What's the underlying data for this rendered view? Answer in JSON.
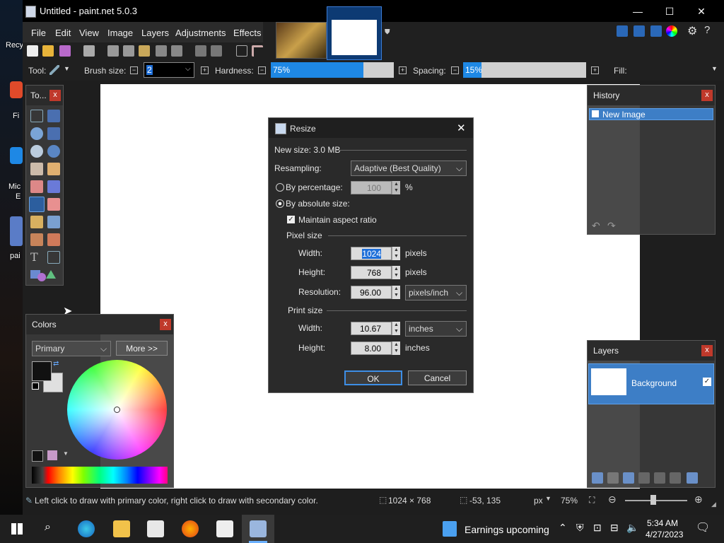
{
  "desktop": {
    "labels": [
      "Recy",
      "Fi",
      "Mic",
      "E",
      "pai"
    ]
  },
  "window": {
    "title": "Untitled - paint.net 5.0.3",
    "min": "—",
    "max": "☐",
    "close": "✕"
  },
  "menu": [
    "File",
    "Edit",
    "View",
    "Image",
    "Layers",
    "Adjustments",
    "Effects"
  ],
  "options": {
    "tool_label": "Tool:",
    "brush_label": "Brush size:",
    "brush_value": "2",
    "hardness_label": "Hardness:",
    "hardness_value": "75%",
    "hardness_fraction": 0.75,
    "spacing_label": "Spacing:",
    "spacing_value": "15%",
    "spacing_fraction": 0.15,
    "fill_label": "Fill:"
  },
  "tools_panel": {
    "title": "To...",
    "close": "x"
  },
  "history_panel": {
    "title": "History",
    "close": "x",
    "item": "New Image"
  },
  "layers_panel": {
    "title": "Layers",
    "close": "x",
    "layer": "Background"
  },
  "colors_panel": {
    "title": "Colors",
    "close": "x",
    "mode": "Primary",
    "more": "More >>"
  },
  "dialog": {
    "title": "Resize",
    "close": "✕",
    "new_size": "New size: 3.0 MB",
    "resampling_label": "Resampling:",
    "resampling_value": "Adaptive (Best Quality)",
    "by_percentage": "By percentage:",
    "percentage_value": "100",
    "percent_sign": "%",
    "by_absolute": "By absolute size:",
    "maintain": "Maintain aspect ratio",
    "pixel_size": "Pixel size",
    "width_label": "Width:",
    "width_value": "1024",
    "height_label": "Height:",
    "height_value": "768",
    "pixels": "pixels",
    "resolution_label": "Resolution:",
    "resolution_value": "96.00",
    "resolution_unit": "pixels/inch",
    "print_size": "Print size",
    "print_width_value": "10.67",
    "print_height_value": "8.00",
    "inches": "inches",
    "ok": "OK",
    "cancel": "Cancel"
  },
  "statusbar": {
    "hint": "Left click to draw with primary color, right click to draw with secondary color.",
    "size": "1024 × 768",
    "cursor": "-53, 135",
    "unit": "px",
    "zoom": "75%"
  },
  "taskbar": {
    "weather": "Earnings upcoming",
    "time": "5:34 AM",
    "date": "4/27/2023"
  },
  "colors": {
    "accent": "#1e88e5",
    "selection": "#3d7ec6",
    "dialog_bg": "#2a2a2a"
  }
}
